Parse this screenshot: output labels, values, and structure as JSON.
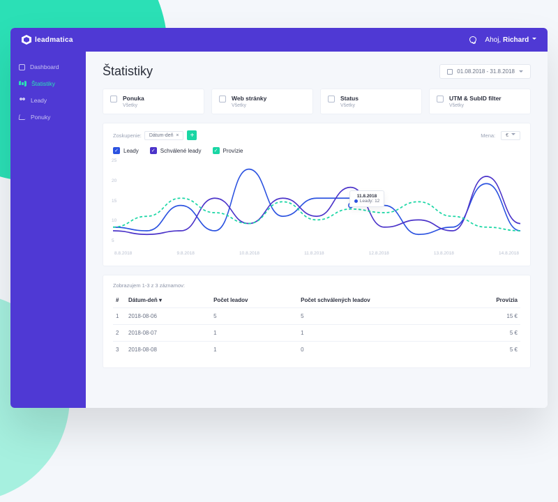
{
  "brand": "leadmatica",
  "greeting_prefix": "Ahoj,",
  "greeting_name": "Richard",
  "sidebar": {
    "items": [
      {
        "label": "Dashboard"
      },
      {
        "label": "Štatistiky"
      },
      {
        "label": "Leady"
      },
      {
        "label": "Ponuky"
      }
    ]
  },
  "page": {
    "title": "Štatistiky",
    "date_range": "01.08.2018 - 31.8.2018"
  },
  "filters": [
    {
      "title": "Ponuka",
      "sub": "Všetky"
    },
    {
      "title": "Web stránky",
      "sub": "Všetky"
    },
    {
      "title": "Status",
      "sub": "Všetky"
    },
    {
      "title": "UTM & SubID filter",
      "sub": "Všetky"
    }
  ],
  "group": {
    "label": "Zoskupenie:",
    "chip": "Dátum-deň"
  },
  "currency": {
    "label": "Mena:",
    "value": "€"
  },
  "legend": [
    {
      "label": "Leady"
    },
    {
      "label": "Schválené leady"
    },
    {
      "label": "Provízie"
    }
  ],
  "chart_data": {
    "type": "line",
    "ylim": [
      0,
      25
    ],
    "yticks": [
      25,
      20,
      15,
      10,
      5
    ],
    "x": [
      "8.8.2018",
      "9.8.2018",
      "10.8.2018",
      "11.8.2018",
      "12.8.2018",
      "13.8.2018",
      "14.8.2018"
    ],
    "series": [
      {
        "name": "Leady",
        "color": "#2b52e0",
        "dash": false,
        "values": [
          6,
          5,
          12,
          5,
          22,
          9,
          14,
          14,
          12,
          4,
          6,
          18,
          5
        ]
      },
      {
        "name": "Schválené leady",
        "color": "#4b33c9",
        "dash": false,
        "values": [
          5,
          4,
          5,
          14,
          7,
          14,
          9,
          17,
          6,
          8,
          5,
          20,
          7
        ]
      },
      {
        "name": "Provízie",
        "color": "#19d6a4",
        "dash": true,
        "values": [
          6,
          9,
          14,
          10,
          7,
          13,
          8,
          11,
          10,
          13,
          9,
          6,
          5
        ]
      }
    ],
    "tooltip": {
      "date": "11.8.2018",
      "series": "Leady",
      "value": 12
    }
  },
  "table": {
    "note": "Zobrazujem 1-3 z 3 záznamov:",
    "headers": [
      "#",
      "Dátum-deň ▾",
      "Počet leadov",
      "Počet schválených leadov",
      "Provízia"
    ],
    "rows": [
      [
        "1",
        "2018-08-06",
        "5",
        "5",
        "15 €"
      ],
      [
        "2",
        "2018-08-07",
        "1",
        "1",
        "5 €"
      ],
      [
        "3",
        "2018-08-08",
        "1",
        "0",
        "5 €"
      ]
    ]
  }
}
